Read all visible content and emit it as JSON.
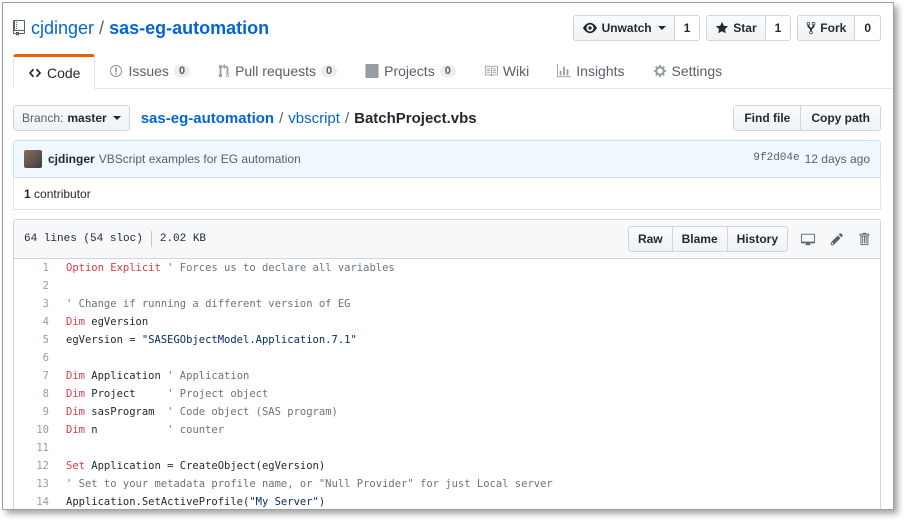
{
  "repo": {
    "owner": "cjdinger",
    "separator": "/",
    "name": "sas-eg-automation"
  },
  "actions": {
    "watch": {
      "label": "Unwatch",
      "count": "1"
    },
    "star": {
      "label": "Star",
      "count": "1"
    },
    "fork": {
      "label": "Fork",
      "count": "0"
    }
  },
  "tabs": [
    {
      "label": "Code",
      "icon": "code-icon",
      "active": true
    },
    {
      "label": "Issues",
      "count": "0",
      "icon": "issue-icon"
    },
    {
      "label": "Pull requests",
      "count": "0",
      "icon": "pull-request-icon"
    },
    {
      "label": "Projects",
      "count": "0",
      "icon": "project-icon"
    },
    {
      "label": "Wiki",
      "icon": "book-icon"
    },
    {
      "label": "Insights",
      "icon": "graph-icon"
    },
    {
      "label": "Settings",
      "icon": "gear-icon"
    }
  ],
  "branch": {
    "label": "Branch:",
    "value": "master"
  },
  "breadcrumb": {
    "root": "sas-eg-automation",
    "dir": "vbscript",
    "file": "BatchProject.vbs",
    "sep": "/"
  },
  "file_buttons": {
    "find": "Find file",
    "copy": "Copy path"
  },
  "commit": {
    "author": "cjdinger",
    "message": "VBScript examples for EG automation",
    "sha": "9f2d04e",
    "time": "12 days ago"
  },
  "contributors": {
    "count": "1",
    "label": "contributor"
  },
  "fileinfo": {
    "lines": "64 lines (54 sloc)",
    "size": "2.02 KB"
  },
  "view_buttons": {
    "raw": "Raw",
    "blame": "Blame",
    "history": "History"
  },
  "code_lines": [
    {
      "n": "1",
      "parts": [
        [
          "kw",
          "Option Explicit"
        ],
        [
          "cm",
          " ' Forces us to declare all variables"
        ]
      ]
    },
    {
      "n": "2",
      "parts": []
    },
    {
      "n": "3",
      "parts": [
        [
          "cm",
          "' Change if running a different version of EG"
        ]
      ]
    },
    {
      "n": "4",
      "parts": [
        [
          "kw",
          "Dim"
        ],
        [
          "ct",
          " egVersion"
        ]
      ]
    },
    {
      "n": "5",
      "parts": [
        [
          "ct",
          "egVersion = "
        ],
        [
          "st",
          "\"SASEGObjectModel.Application.7.1\""
        ]
      ]
    },
    {
      "n": "6",
      "parts": []
    },
    {
      "n": "7",
      "parts": [
        [
          "kw",
          "Dim"
        ],
        [
          "ct",
          " Application "
        ],
        [
          "cm",
          "' Application"
        ]
      ]
    },
    {
      "n": "8",
      "parts": [
        [
          "kw",
          "Dim"
        ],
        [
          "ct",
          " Project     "
        ],
        [
          "cm",
          "' Project object"
        ]
      ]
    },
    {
      "n": "9",
      "parts": [
        [
          "kw",
          "Dim"
        ],
        [
          "ct",
          " sasProgram  "
        ],
        [
          "cm",
          "' Code object (SAS program)"
        ]
      ]
    },
    {
      "n": "10",
      "parts": [
        [
          "kw",
          "Dim"
        ],
        [
          "ct",
          " n           "
        ],
        [
          "cm",
          "' counter"
        ]
      ]
    },
    {
      "n": "11",
      "parts": []
    },
    {
      "n": "12",
      "parts": [
        [
          "kw",
          "Set"
        ],
        [
          "ct",
          " Application = CreateObject(egVersion)"
        ]
      ]
    },
    {
      "n": "13",
      "parts": [
        [
          "cm",
          "' Set to your metadata profile name, or \"Null Provider\" for just Local server"
        ]
      ]
    },
    {
      "n": "14",
      "parts": [
        [
          "ct",
          "Application.SetActiveProfile("
        ],
        [
          "st",
          "\"My Server\""
        ],
        [
          "ct",
          ")"
        ]
      ]
    }
  ]
}
